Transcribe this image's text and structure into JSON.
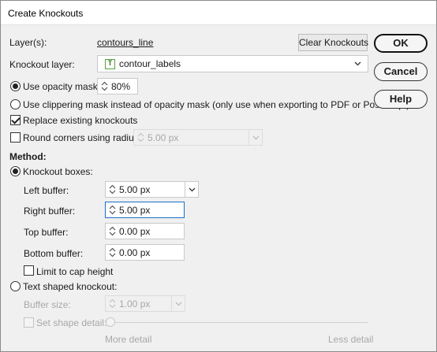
{
  "window": {
    "title": "Create Knockouts"
  },
  "layers": {
    "label": "Layer(s):",
    "value": "contours_line",
    "clear_button": "Clear Knockouts"
  },
  "knockout_layer": {
    "label": "Knockout layer:",
    "value": "contour_labels",
    "icon": "text-layer-icon",
    "icon_glyph": "T"
  },
  "opacity": {
    "label": "Use opacity mask:",
    "value": "80%",
    "selected": true
  },
  "clipping": {
    "label": "Use clippering mask instead of opacity mask (only use when exporting to PDF or PostScript)",
    "selected": false
  },
  "replace": {
    "label": "Replace existing knockouts",
    "checked": true
  },
  "round_corners": {
    "label": "Round corners using radius:",
    "value": "5.00 px",
    "checked": false,
    "enabled": false
  },
  "method": {
    "heading": "Method:",
    "boxes": {
      "label": "Knockout boxes:",
      "selected": true
    },
    "left_buffer": {
      "label": "Left buffer:",
      "value": "5.00 px"
    },
    "right_buffer": {
      "label": "Right buffer:",
      "value": "5.00 px"
    },
    "top_buffer": {
      "label": "Top buffer:",
      "value": "0.00 px"
    },
    "bottom_buffer": {
      "label": "Bottom buffer:",
      "value": "0.00 px"
    },
    "cap_height": {
      "label": "Limit to cap height",
      "checked": false
    },
    "shaped": {
      "label": "Text shaped knockout:",
      "selected": false
    },
    "buffer_size": {
      "label": "Buffer size:",
      "value": "1.00 px",
      "enabled": false
    },
    "shape_detail": {
      "label": "Set shape detail:",
      "checked": false,
      "enabled": false,
      "min_label": "More detail",
      "max_label": "Less detail",
      "level": 0
    }
  },
  "buttons": {
    "ok": "OK",
    "cancel": "Cancel",
    "help": "Help"
  },
  "colors": {
    "focus": "#1a6fc9",
    "disabled_text": "#a8a8a8",
    "layer_icon": "#5aa33a"
  }
}
